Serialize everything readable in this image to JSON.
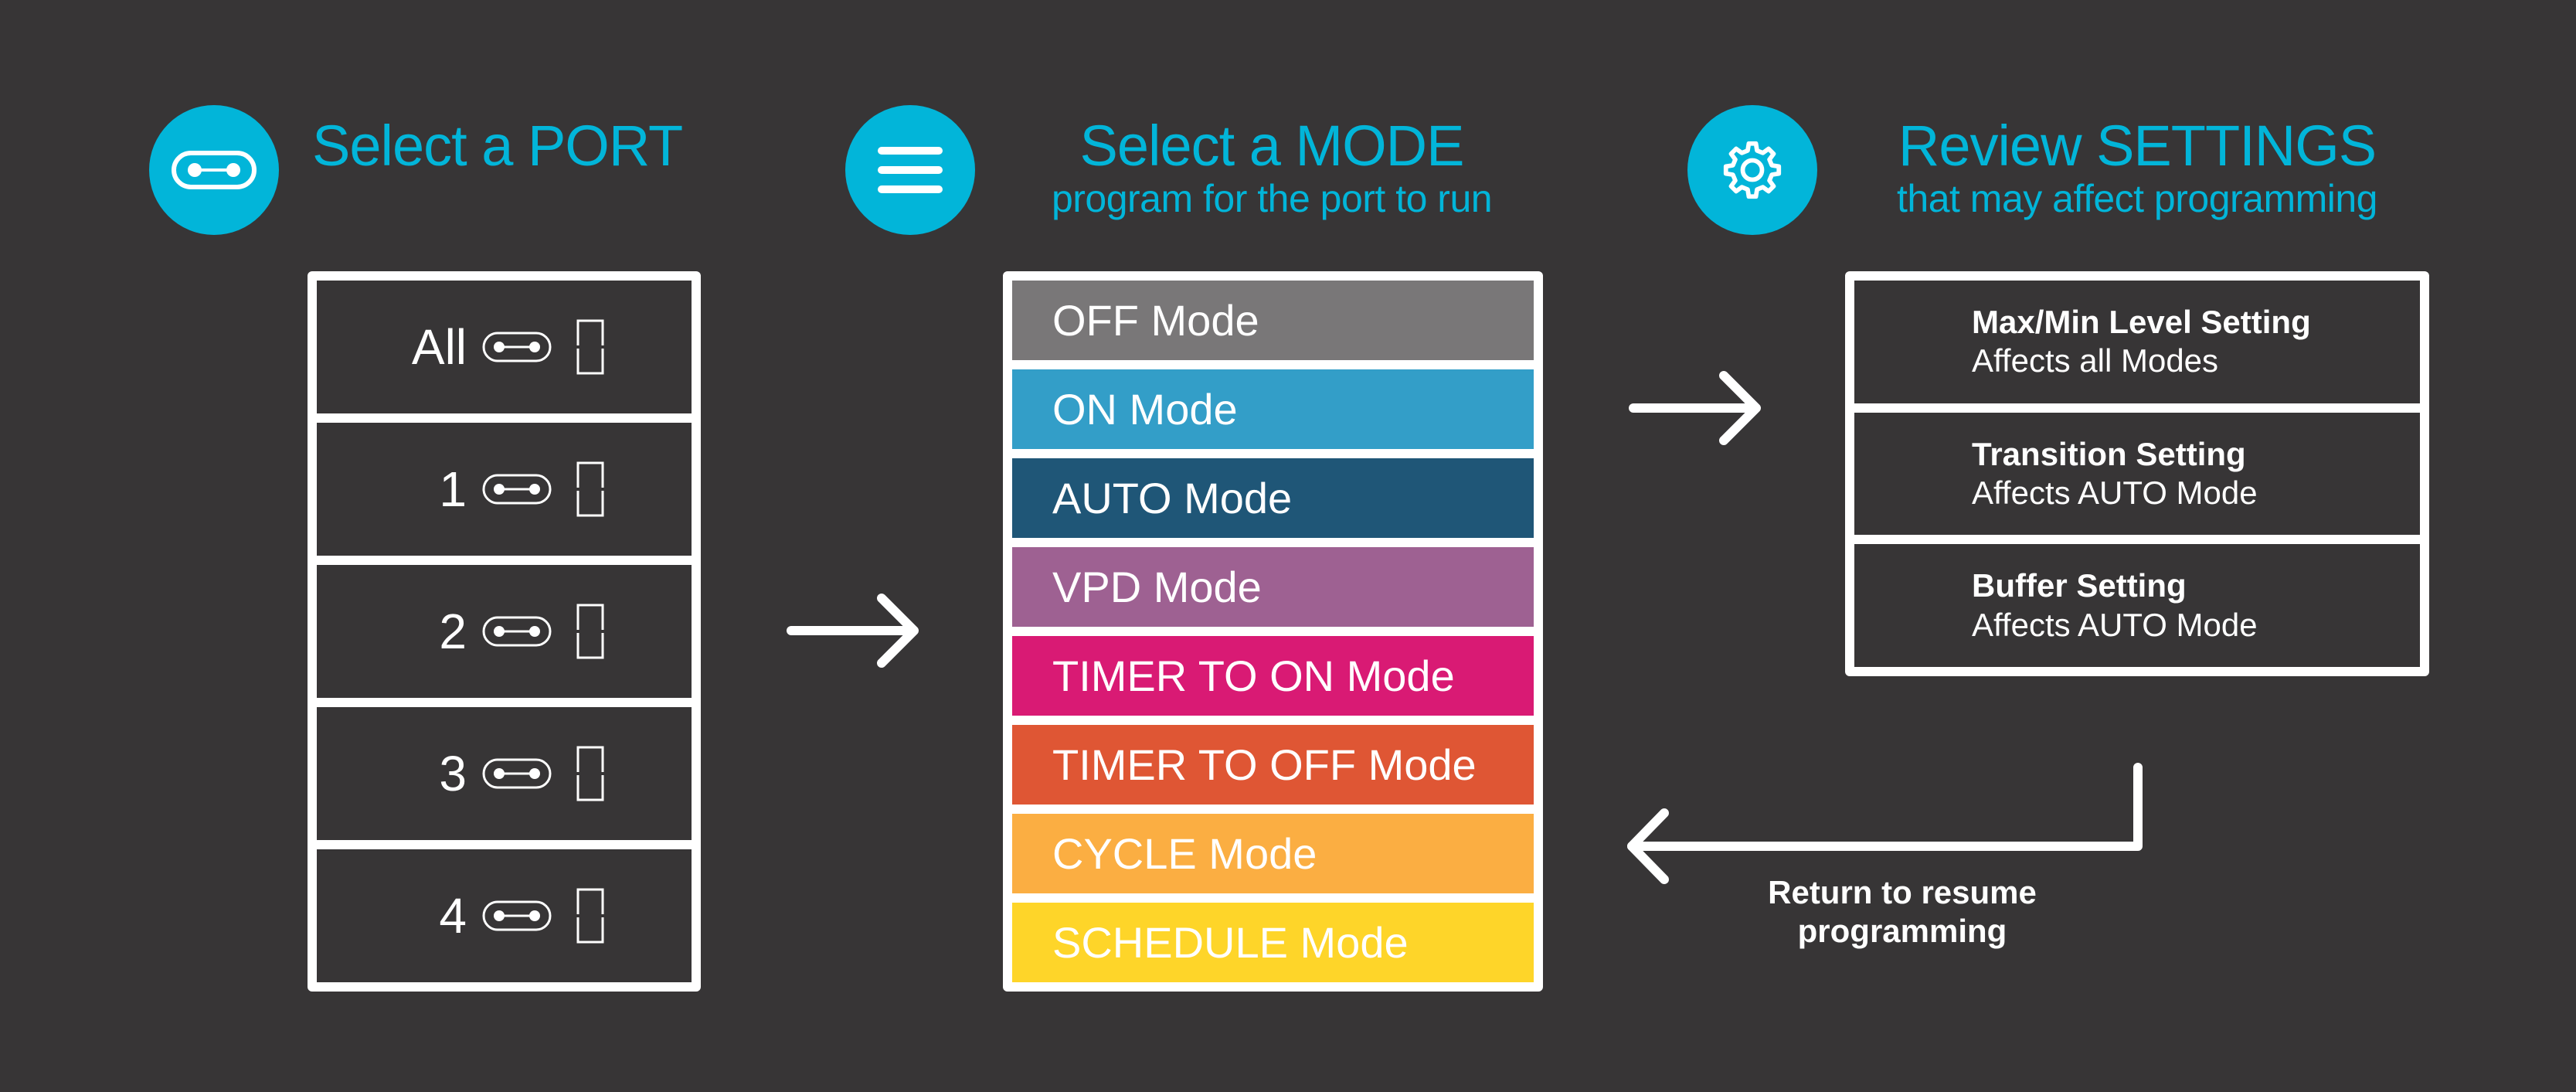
{
  "colors": {
    "background": "#373536",
    "accent": "#02b5d9",
    "box_border": "#ffffff"
  },
  "steps": [
    {
      "icon": "port-icon",
      "title": "Select a PORT",
      "subtitle": ""
    },
    {
      "icon": "menu-icon",
      "title": "Select a MODE",
      "subtitle": "program for the port to run"
    },
    {
      "icon": "gear-icon",
      "title": "Review SETTINGS",
      "subtitle": "that may affect programming"
    }
  ],
  "ports": [
    {
      "label": "All",
      "icon": "port-icon",
      "indicator": "seven-segment-digit-icon"
    },
    {
      "label": "1",
      "icon": "port-icon",
      "indicator": "seven-segment-digit-icon"
    },
    {
      "label": "2",
      "icon": "port-icon",
      "indicator": "seven-segment-digit-icon"
    },
    {
      "label": "3",
      "icon": "port-icon",
      "indicator": "seven-segment-digit-icon"
    },
    {
      "label": "4",
      "icon": "port-icon",
      "indicator": "seven-segment-digit-icon"
    }
  ],
  "modes": [
    {
      "label": "OFF Mode",
      "color": "#797778"
    },
    {
      "label": "ON Mode",
      "color": "#339ec8"
    },
    {
      "label": "AUTO Mode",
      "color": "#1f5677"
    },
    {
      "label": "VPD Mode",
      "color": "#9e6192"
    },
    {
      "label": "TIMER TO ON Mode",
      "color": "#d91a74"
    },
    {
      "label": "TIMER TO OFF Mode",
      "color": "#df5634"
    },
    {
      "label": "CYCLE Mode",
      "color": "#fbae42"
    },
    {
      "label": "SCHEDULE Mode",
      "color": "#fed529"
    }
  ],
  "settings": [
    {
      "title": "Max/Min Level Setting",
      "description": "Affects all Modes"
    },
    {
      "title": "Transition Setting",
      "description": "Affects AUTO Mode"
    },
    {
      "title": "Buffer Setting",
      "description": "Affects AUTO Mode"
    }
  ],
  "return_note": {
    "line1": "Return to resume",
    "line2": "programming"
  }
}
